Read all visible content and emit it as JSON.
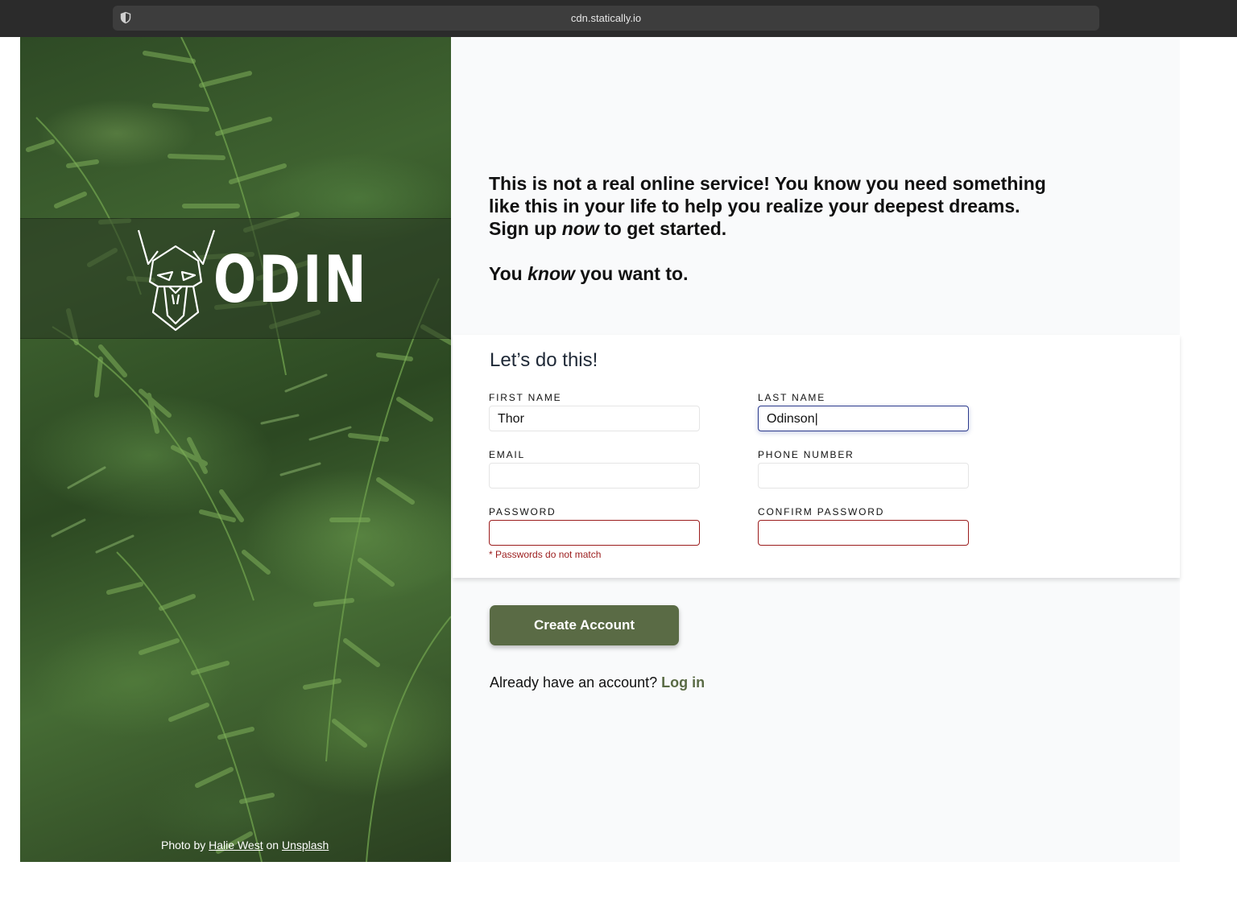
{
  "browser": {
    "url": "cdn.statically.io"
  },
  "hero": {
    "logo_text": "ODIN",
    "credit": {
      "prefix": "Photo by",
      "author": "Halie West",
      "middle": "on",
      "site": "Unsplash"
    }
  },
  "intro": {
    "line1": "This is not a real online service! You know you need something like this in your life to help you realize your deepest dreams. Sign up",
    "emph1": "now",
    "line1_tail": "to get started.",
    "line2_head": "You",
    "emph2": "know",
    "line2_tail": "you want to."
  },
  "form": {
    "title": "Let’s do this!",
    "fields": {
      "first_name": {
        "label": "FIRST NAME",
        "value": "Thor"
      },
      "last_name": {
        "label": "LAST NAME",
        "value": "Odinson|"
      },
      "email": {
        "label": "EMAIL",
        "value": ""
      },
      "phone": {
        "label": "PHONE NUMBER",
        "value": ""
      },
      "password": {
        "label": "PASSWORD",
        "value": "",
        "error": "* Passwords do not match"
      },
      "confirm_password": {
        "label": "CONFIRM PASSWORD",
        "value": ""
      }
    }
  },
  "actions": {
    "create_label": "Create Account",
    "login_prompt": "Already have an account?",
    "login_link": "Log in"
  },
  "colors": {
    "accent": "#5a6b45",
    "error": "#9b1c1c",
    "focus": "#2b3a8c"
  }
}
